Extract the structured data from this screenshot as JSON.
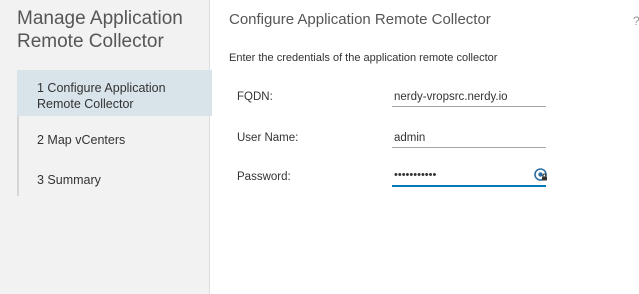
{
  "sidebar": {
    "title": "Manage Application Remote Collector",
    "steps": [
      {
        "label": "1 Configure Application Remote Collector",
        "active": true
      },
      {
        "label": "2 Map vCenters",
        "active": false
      },
      {
        "label": "3 Summary",
        "active": false
      }
    ]
  },
  "main": {
    "title": "Configure Application Remote Collector",
    "help_glyph": "?",
    "subtitle": "Enter the credentials of the application remote collector",
    "fields": {
      "fqdn": {
        "label": "FQDN:",
        "value": "nerdy-vropsrc.nerdy.io"
      },
      "username": {
        "label": "User Name:",
        "value": "admin"
      },
      "password": {
        "label": "Password:",
        "masked_value": "•••••••••••",
        "icon": "password-manager-icon"
      }
    }
  },
  "colors": {
    "sidebar_bg": "#f2f2f2",
    "active_step_bg": "#d8e4ea",
    "focus_underline": "#0079b8"
  }
}
